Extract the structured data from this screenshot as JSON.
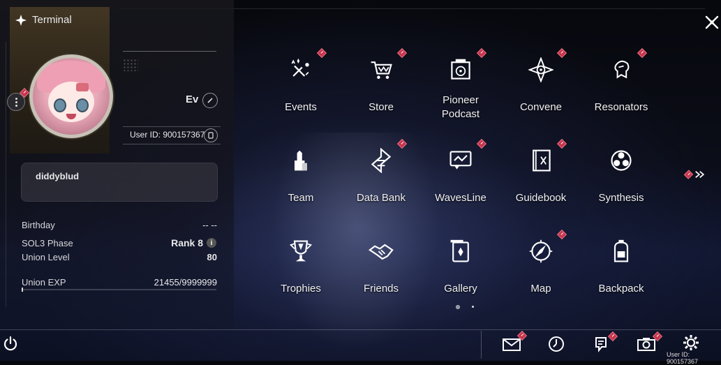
{
  "window": {
    "title": "Terminal"
  },
  "profile": {
    "name": "Ev",
    "uid_label": "User ID: 900157367",
    "signature": "diddyblud",
    "stats": [
      {
        "label": "Birthday",
        "value": "-- --"
      },
      {
        "label": "SOL3 Phase",
        "value": "Rank 8"
      },
      {
        "label": "Union Level",
        "value": "80"
      },
      {
        "label": "Union EXP",
        "value": "21455/9999999"
      }
    ],
    "exp_fraction": 0.00215
  },
  "grid": {
    "items": [
      {
        "label": "Events",
        "icon": "events-icon",
        "badge": true
      },
      {
        "label": "Store",
        "icon": "store-cart-icon",
        "badge": true
      },
      {
        "label": "Pioneer Podcast",
        "icon": "podcast-icon",
        "badge": true
      },
      {
        "label": "Convene",
        "icon": "convene-icon",
        "badge": true
      },
      {
        "label": "Resonators",
        "icon": "resonators-icon",
        "badge": true
      },
      {
        "label": "Team",
        "icon": "team-icon",
        "badge": false
      },
      {
        "label": "Data Bank",
        "icon": "data-bank-icon",
        "badge": true
      },
      {
        "label": "WavesLine",
        "icon": "wavesline-icon",
        "badge": true
      },
      {
        "label": "Guidebook",
        "icon": "guidebook-icon",
        "badge": true
      },
      {
        "label": "Synthesis",
        "icon": "synthesis-icon",
        "badge": false
      },
      {
        "label": "Trophies",
        "icon": "trophy-icon",
        "badge": false
      },
      {
        "label": "Friends",
        "icon": "handshake-icon",
        "badge": false
      },
      {
        "label": "Gallery",
        "icon": "gallery-icon",
        "badge": false
      },
      {
        "label": "Map",
        "icon": "compass-icon",
        "badge": true
      },
      {
        "label": "Backpack",
        "icon": "backpack-icon",
        "badge": false
      }
    ],
    "page_current": 1,
    "page_total": 2
  },
  "bottom_bar": {
    "uid_label": "User ID: 900157367",
    "icons": [
      "mail-icon",
      "clock-icon",
      "notice-icon",
      "camera-icon",
      "settings-gear-icon"
    ]
  },
  "colors": {
    "badge": "#c8354e",
    "accent": "#e8e8ea"
  }
}
